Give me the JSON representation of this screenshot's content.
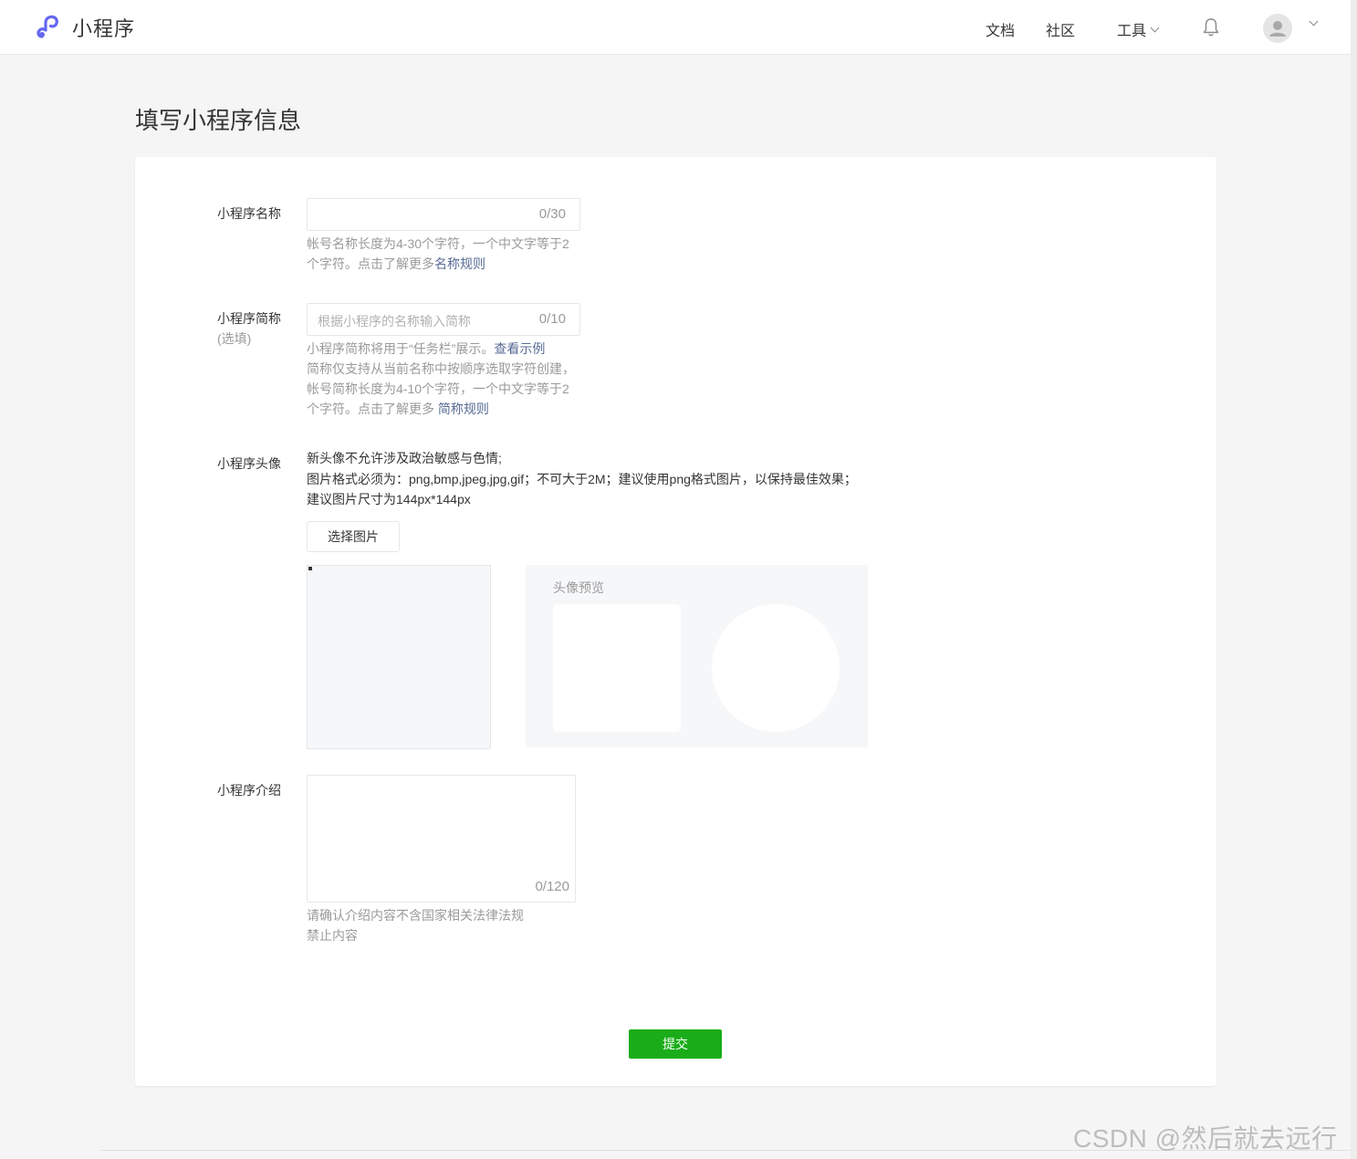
{
  "header": {
    "app_title": "小程序",
    "nav": {
      "docs": "文档",
      "community": "社区",
      "tools": "工具"
    },
    "brand_color": "#6467f0"
  },
  "page": {
    "title": "填写小程序信息"
  },
  "form": {
    "name": {
      "label": "小程序名称",
      "counter": "0/30",
      "tip_text": "帐号名称长度为4-30个字符，一个中文字等于2个字符。点击了解更多",
      "tip_link": "名称规则"
    },
    "short_name": {
      "label": "小程序简称",
      "label_sub": "(选填)",
      "placeholder": "根据小程序的名称输入简称",
      "counter": "0/10",
      "tip_line1": "小程序简称将用于“任务栏”展示。",
      "tip_link1": "查看示例",
      "tip_line2": "简称仅支持从当前名称中按顺序选取字符创建，",
      "tip_line3": "帐号简称长度为4-10个字符，一个中文字等于2",
      "tip_line4": "个字符。点击了解更多 ",
      "tip_link2": "简称规则"
    },
    "avatar": {
      "label": "小程序头像",
      "desc_line1": "新头像不允许涉及政治敏感与色情;",
      "desc_line2": "图片格式必须为：png,bmp,jpeg,jpg,gif；不可大于2M；建议使用png格式图片，以保持最佳效果；建议图片尺寸为144px*144px",
      "choose_button": "选择图片",
      "preview_title": "头像预览"
    },
    "intro": {
      "label": "小程序介绍",
      "counter": "0/120",
      "tip": "请确认介绍内容不含国家相关法律法规禁止内容"
    },
    "submit_button": "提交",
    "submit_color": "#1aad19"
  },
  "watermark": "CSDN @然后就去远行吧"
}
